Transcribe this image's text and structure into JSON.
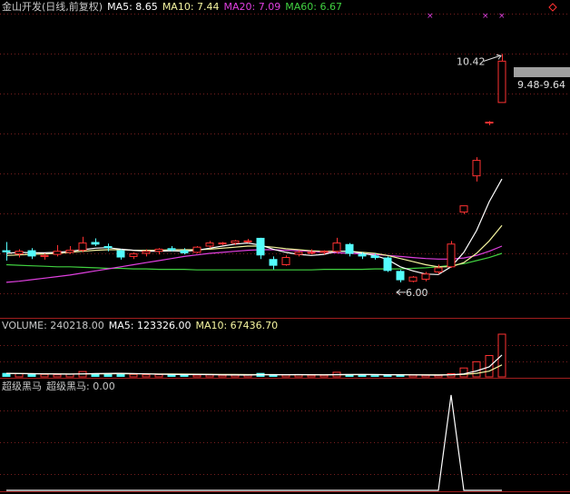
{
  "price_header": [
    {
      "text": "金山开发(日线,前复权)",
      "color": "#C8C8C8"
    },
    {
      "text": "MA5: 8.65",
      "color": "#FFFFFF"
    },
    {
      "text": "MA10: 7.44",
      "color": "#F5F5A0"
    },
    {
      "text": "MA20: 7.09",
      "color": "#E040E0"
    },
    {
      "text": "MA60: 6.67",
      "color": "#40D040"
    }
  ],
  "volume_header": [
    {
      "text": "VOLUME: 240218.00",
      "color": "#C8C8C8"
    },
    {
      "text": "MA5: 123326.00",
      "color": "#FFFFFF"
    },
    {
      "text": "MA10: 67436.70",
      "color": "#F5F5A0"
    }
  ],
  "indicator_header": [
    {
      "text": "超级黑马",
      "color": "#C8C8C8"
    },
    {
      "text": "超级黑马: 0.00",
      "color": "#C8C8C8"
    }
  ],
  "price_tag": "9.48-9.64",
  "chart_data": [
    {
      "type": "candlestick",
      "ylim": [
        5.4,
        11.2
      ],
      "up_color": "#FF3232",
      "down_color": "#54FCFC",
      "candles": [
        {
          "o": 6.62,
          "h": 6.78,
          "l": 6.42,
          "c": 6.58
        },
        {
          "o": 6.55,
          "h": 6.64,
          "l": 6.48,
          "c": 6.6
        },
        {
          "o": 6.62,
          "h": 6.66,
          "l": 6.45,
          "c": 6.5
        },
        {
          "o": 6.5,
          "h": 6.56,
          "l": 6.44,
          "c": 6.52
        },
        {
          "o": 6.54,
          "h": 6.72,
          "l": 6.5,
          "c": 6.6
        },
        {
          "o": 6.58,
          "h": 6.7,
          "l": 6.55,
          "c": 6.62
        },
        {
          "o": 6.62,
          "h": 6.88,
          "l": 6.58,
          "c": 6.76
        },
        {
          "o": 6.78,
          "h": 6.85,
          "l": 6.7,
          "c": 6.73
        },
        {
          "o": 6.7,
          "h": 6.75,
          "l": 6.6,
          "c": 6.66
        },
        {
          "o": 6.62,
          "h": 6.64,
          "l": 6.44,
          "c": 6.48
        },
        {
          "o": 6.5,
          "h": 6.58,
          "l": 6.45,
          "c": 6.55
        },
        {
          "o": 6.56,
          "h": 6.64,
          "l": 6.5,
          "c": 6.6
        },
        {
          "o": 6.6,
          "h": 6.66,
          "l": 6.54,
          "c": 6.64
        },
        {
          "o": 6.66,
          "h": 6.7,
          "l": 6.6,
          "c": 6.62
        },
        {
          "o": 6.62,
          "h": 6.66,
          "l": 6.54,
          "c": 6.56
        },
        {
          "o": 6.58,
          "h": 6.7,
          "l": 6.56,
          "c": 6.68
        },
        {
          "o": 6.7,
          "h": 6.8,
          "l": 6.66,
          "c": 6.76
        },
        {
          "o": 6.76,
          "h": 6.78,
          "l": 6.72,
          "c": 6.76
        },
        {
          "o": 6.76,
          "h": 6.82,
          "l": 6.72,
          "c": 6.8
        },
        {
          "o": 6.8,
          "h": 6.84,
          "l": 6.76,
          "c": 6.8
        },
        {
          "o": 6.86,
          "h": 6.86,
          "l": 6.45,
          "c": 6.52
        },
        {
          "o": 6.45,
          "h": 6.5,
          "l": 6.25,
          "c": 6.32
        },
        {
          "o": 6.34,
          "h": 6.52,
          "l": 6.32,
          "c": 6.48
        },
        {
          "o": 6.54,
          "h": 6.62,
          "l": 6.5,
          "c": 6.58
        },
        {
          "o": 6.58,
          "h": 6.64,
          "l": 6.54,
          "c": 6.58
        },
        {
          "o": 6.58,
          "h": 6.62,
          "l": 6.54,
          "c": 6.6
        },
        {
          "o": 6.6,
          "h": 6.86,
          "l": 6.56,
          "c": 6.76
        },
        {
          "o": 6.74,
          "h": 6.76,
          "l": 6.5,
          "c": 6.55
        },
        {
          "o": 6.55,
          "h": 6.58,
          "l": 6.45,
          "c": 6.5
        },
        {
          "o": 6.52,
          "h": 6.56,
          "l": 6.44,
          "c": 6.47
        },
        {
          "o": 6.48,
          "h": 6.5,
          "l": 6.2,
          "c": 6.22
        },
        {
          "o": 6.22,
          "h": 6.24,
          "l": 6.0,
          "c": 6.04
        },
        {
          "o": 6.02,
          "h": 6.12,
          "l": 6.0,
          "c": 6.1
        },
        {
          "o": 6.06,
          "h": 6.2,
          "l": 6.02,
          "c": 6.16
        },
        {
          "o": 6.2,
          "h": 6.34,
          "l": 6.16,
          "c": 6.28
        },
        {
          "o": 6.3,
          "h": 6.8,
          "l": 6.28,
          "c": 6.74
        },
        {
          "o": 7.36,
          "h": 7.48,
          "l": 7.32,
          "c": 7.48
        },
        {
          "o": 8.06,
          "h": 8.42,
          "l": 7.95,
          "c": 8.36
        },
        {
          "o": 9.1,
          "h": 9.12,
          "l": 9.04,
          "c": 9.1
        },
        {
          "o": 9.48,
          "h": 10.42,
          "l": 9.48,
          "c": 10.28
        }
      ],
      "ma5": [
        6.56,
        6.58,
        6.57,
        6.57,
        6.58,
        6.6,
        6.63,
        6.66,
        6.67,
        6.64,
        6.62,
        6.6,
        6.6,
        6.61,
        6.6,
        6.62,
        6.66,
        6.7,
        6.74,
        6.76,
        6.72,
        6.64,
        6.58,
        6.54,
        6.52,
        6.54,
        6.6,
        6.6,
        6.56,
        6.52,
        6.44,
        6.3,
        6.22,
        6.16,
        6.15,
        6.3,
        6.58,
        7.0,
        7.56,
        8.0
      ],
      "ma10": [
        6.52,
        6.53,
        6.54,
        6.55,
        6.56,
        6.58,
        6.6,
        6.62,
        6.63,
        6.63,
        6.62,
        6.62,
        6.62,
        6.63,
        6.63,
        6.63,
        6.64,
        6.66,
        6.68,
        6.7,
        6.7,
        6.68,
        6.65,
        6.63,
        6.61,
        6.6,
        6.6,
        6.6,
        6.58,
        6.56,
        6.52,
        6.46,
        6.4,
        6.34,
        6.3,
        6.3,
        6.38,
        6.56,
        6.8,
        7.1
      ],
      "ma20": [
        6.0,
        6.02,
        6.05,
        6.08,
        6.11,
        6.14,
        6.18,
        6.22,
        6.26,
        6.3,
        6.34,
        6.38,
        6.42,
        6.46,
        6.5,
        6.53,
        6.56,
        6.58,
        6.6,
        6.62,
        6.63,
        6.63,
        6.62,
        6.61,
        6.6,
        6.58,
        6.57,
        6.56,
        6.55,
        6.54,
        6.52,
        6.5,
        6.48,
        6.46,
        6.45,
        6.45,
        6.47,
        6.52,
        6.6,
        6.7
      ],
      "ma60": [
        6.34,
        6.33,
        6.32,
        6.31,
        6.3,
        6.3,
        6.29,
        6.28,
        6.27,
        6.27,
        6.26,
        6.26,
        6.25,
        6.25,
        6.25,
        6.24,
        6.24,
        6.24,
        6.24,
        6.24,
        6.24,
        6.24,
        6.24,
        6.24,
        6.24,
        6.25,
        6.25,
        6.25,
        6.25,
        6.26,
        6.26,
        6.26,
        6.27,
        6.28,
        6.3,
        6.33,
        6.36,
        6.42,
        6.48,
        6.56
      ],
      "annotations": [
        {
          "text": "10.42",
          "value": 10.42,
          "index": 39,
          "kind": "high"
        },
        {
          "text": "6.00",
          "value": 6.0,
          "index": 31,
          "kind": "low"
        }
      ]
    },
    {
      "type": "bar",
      "series_name": "VOLUME",
      "ylim": [
        0,
        240218
      ],
      "values": [
        22000,
        18000,
        16000,
        14000,
        12000,
        15000,
        30000,
        18000,
        20000,
        16000,
        14000,
        12000,
        13000,
        14000,
        12000,
        10000,
        11000,
        9000,
        9500,
        10000,
        22000,
        12000,
        10000,
        11000,
        9000,
        9000,
        26000,
        13000,
        10000,
        9000,
        10000,
        11000,
        9500,
        9000,
        9000,
        18000,
        50000,
        85000,
        120000,
        240218
      ],
      "up_color": "#FF3232",
      "down_color": "#54FCFC",
      "ma5": [
        20000,
        19000,
        18000,
        17000,
        16000,
        15500,
        17000,
        18500,
        19500,
        20000,
        19000,
        17000,
        15000,
        14000,
        13000,
        13500,
        13000,
        11000,
        10500,
        10000,
        12000,
        12500,
        12500,
        13000,
        12000,
        11000,
        13000,
        14000,
        13500,
        13000,
        12500,
        11500,
        11000,
        10000,
        9500,
        11500,
        17000,
        33000,
        56000,
        123326
      ],
      "ma10": [
        19000,
        18500,
        18000,
        17500,
        17000,
        16500,
        16500,
        17000,
        17500,
        18000,
        17500,
        17000,
        16500,
        16000,
        15500,
        15000,
        14500,
        14000,
        13500,
        13000,
        12800,
        12600,
        12400,
        12300,
        12200,
        12000,
        12200,
        12400,
        12600,
        12800,
        12500,
        12200,
        12000,
        11800,
        11600,
        12000,
        14000,
        20000,
        32000,
        67436.7
      ]
    },
    {
      "type": "line",
      "series_name": "超级黑马",
      "ylim": [
        0,
        1
      ],
      "values": [
        0,
        0,
        0,
        0,
        0,
        0,
        0,
        0,
        0,
        0,
        0,
        0,
        0,
        0,
        0,
        0,
        0,
        0,
        0,
        0,
        0,
        0,
        0,
        0,
        0,
        0,
        0,
        0,
        0,
        0,
        0,
        0,
        0,
        0,
        0,
        1,
        0,
        0,
        0,
        0
      ]
    }
  ]
}
